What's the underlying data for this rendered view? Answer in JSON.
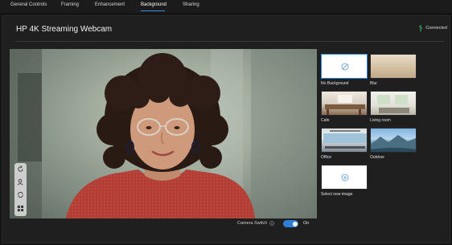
{
  "tabs": [
    {
      "label": "General Controls",
      "active": false
    },
    {
      "label": "Framing",
      "active": false
    },
    {
      "label": "Enhancement",
      "active": false
    },
    {
      "label": "Background",
      "active": true
    },
    {
      "label": "Sharing",
      "active": false
    }
  ],
  "header": {
    "title": "HP 4K Streaming Webcam",
    "status": "Connected",
    "status_icon": "usb-icon"
  },
  "video_controls": [
    "rotate-icon",
    "person-search-icon",
    "swap-icon",
    "grid-icon"
  ],
  "backgrounds": [
    {
      "label": "No Background",
      "icon": "no-background-icon",
      "selected": true
    },
    {
      "label": "Blur",
      "selected": false
    },
    {
      "label": "Cafe",
      "selected": false
    },
    {
      "label": "Living room",
      "selected": false
    },
    {
      "label": "Office",
      "selected": false
    },
    {
      "label": "Outdoor",
      "selected": false
    },
    {
      "label": "Select new image",
      "icon": "add-icon",
      "selected": false
    }
  ],
  "camera_switch": {
    "label": "Camera Switch",
    "state": "On",
    "enabled": true
  },
  "colors": {
    "accent": "#2d87d9",
    "status_green": "#39c163",
    "panel_bg": "#1f1f1f"
  }
}
